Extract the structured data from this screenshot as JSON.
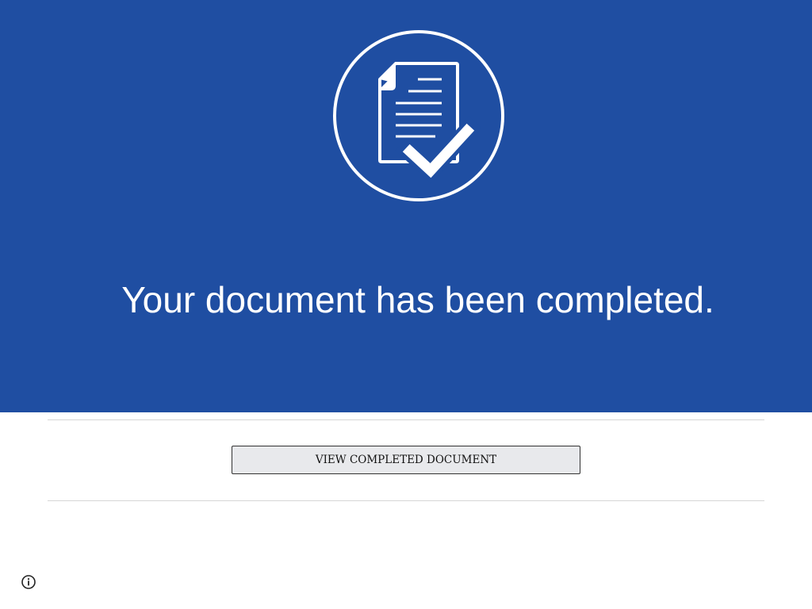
{
  "hero": {
    "title": "Your document has been completed.",
    "icon": "document-check-icon",
    "background_color": "#1f4ea2"
  },
  "actions": {
    "view_completed_document_label": "VIEW COMPLETED DOCUMENT"
  },
  "footer": {
    "icon": "info-icon"
  }
}
